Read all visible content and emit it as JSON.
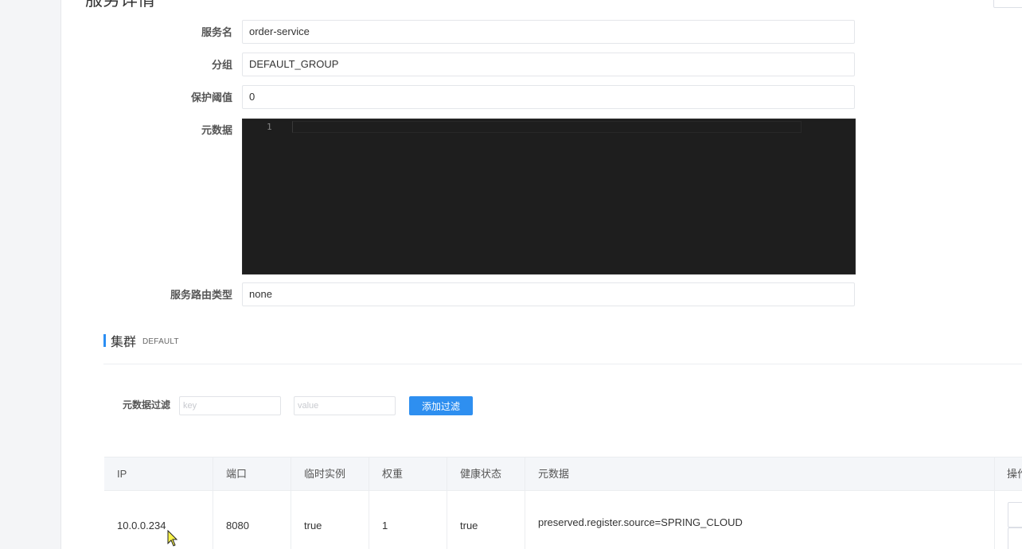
{
  "page": {
    "title": "服务详情"
  },
  "form": {
    "service_name": {
      "label": "服务名",
      "value": "order-service"
    },
    "group": {
      "label": "分组",
      "value": "DEFAULT_GROUP"
    },
    "protect_threshold": {
      "label": "保护阈值",
      "value": "0"
    },
    "metadata": {
      "label": "元数据",
      "line_number": "1",
      "content": ""
    },
    "selector_type": {
      "label": "服务路由类型",
      "value": "none"
    }
  },
  "cluster": {
    "title": "集群",
    "name": "DEFAULT",
    "filter": {
      "label": "元数据过滤",
      "key_placeholder": "key",
      "value_placeholder": "value",
      "button_label": "添加过滤"
    },
    "table": {
      "headers": [
        "IP",
        "端口",
        "临时实例",
        "权重",
        "健康状态",
        "元数据",
        "操作"
      ],
      "rows": [
        {
          "ip": "10.0.0.234",
          "port": "8080",
          "ephemeral": "true",
          "weight": "1",
          "healthy": "true",
          "metadata": "preserved.register.source=SPRING_CLOUD"
        }
      ]
    }
  },
  "colors": {
    "accent": "#2e8ff0",
    "editor_bg": "#1e1e1e"
  }
}
